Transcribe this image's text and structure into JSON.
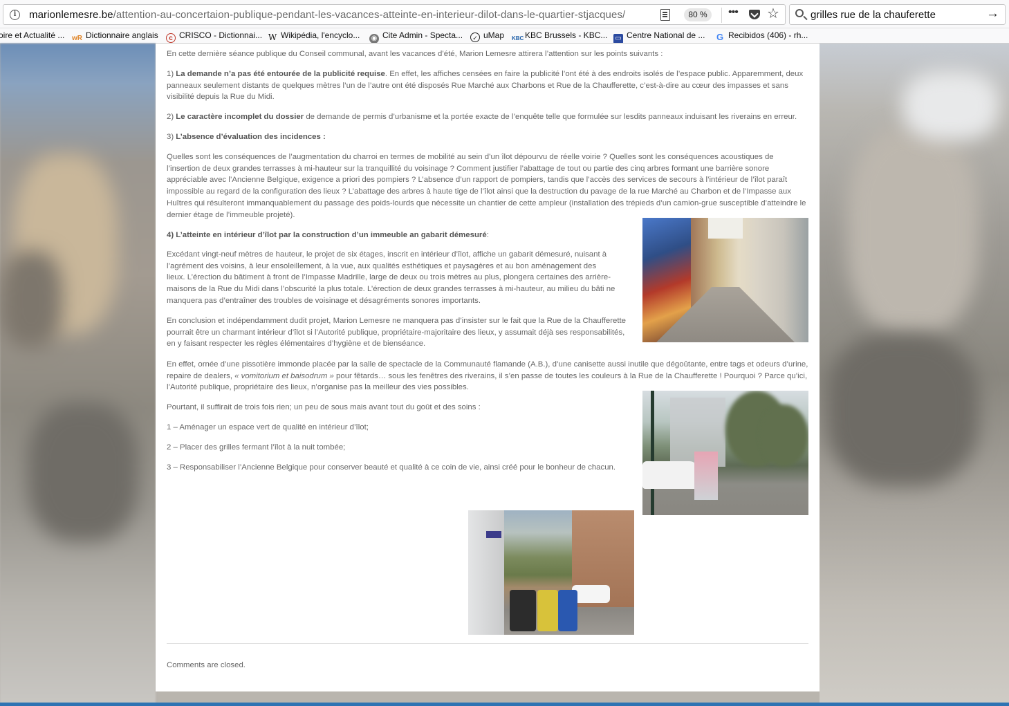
{
  "browser": {
    "url_domain": "marionlemesre.be",
    "url_path": "/attention-au-concertaion-publique-pendant-les-vacances-atteinte-en-interieur-dilot-dans-le-quartier-stjacques/",
    "zoom": "80 %",
    "search_query": "grilles rue de la chauferette",
    "bookmarks": [
      {
        "label": "oire et Actualité ...",
        "icon": "bookmark-icon"
      },
      {
        "label": "Dictionnaire anglais",
        "icon": "wordreference-icon"
      },
      {
        "label": "CRISCO - Dictionnai...",
        "icon": "crisco-icon"
      },
      {
        "label": "Wikipédia, l'encyclo...",
        "icon": "wikipedia-icon"
      },
      {
        "label": "Cite Admin - Specta...",
        "icon": "globe-icon"
      },
      {
        "label": "uMap",
        "icon": "umap-icon"
      },
      {
        "label": "KBC Brussels - KBC...",
        "icon": "kbc-icon"
      },
      {
        "label": "Centre National de ...",
        "icon": "cnrtl-icon"
      },
      {
        "label": "Recibidos (406) - rh...",
        "icon": "google-icon"
      }
    ]
  },
  "article": {
    "intro": "En cette dernière séance publique du Conseil communal, avant les vacances d’été, Marion Lemesre attirera l’attention sur les points suivants :",
    "p1_num": "1) ",
    "p1_bold": "La demande n’a pas été entourée de la publicité requise",
    "p1_rest": ". En effet, les affiches censées en faire la publicité l’ont été à des endroits isolés de l’espace public. Apparemment, deux panneaux seulement distants de quelques mètres l’un de l’autre ont été disposés Rue Marché aux Charbons et Rue de la Chaufferette, c’est-à-dire au cœur des impasses et sans visibilité depuis la Rue du Midi.",
    "p2_num": "2) ",
    "p2_bold": "Le caractère incomplet du dossier",
    "p2_rest": " de demande de permis d’urbanisme et la portée exacte de l’enquête telle que formulée sur lesdits panneaux induisant les riverains en erreur.",
    "p3_num": "3) ",
    "p3_bold": "L’absence d’évaluation des incidences :",
    "p4": "Quelles sont les conséquences de l’augmentation du charroi en termes de mobilité au sein d’un îlot dépourvu de réelle voirie ? Quelles sont les conséquences acoustiques de l’insertion de deux grandes terrasses à mi-hauteur sur la tranquillité du voisinage ? Comment justifier l’abattage de tout ou partie des cinq arbres formant une barrière sonore appréciable avec l’Ancienne Belgique, exigence a priori des pompiers ? L’absence d’un rapport de pompiers, tandis que l’accès des services de secours à l’intérieur de l’îlot paraît impossible au regard de la configuration des lieux ? L’abattage des arbres à haute tige de l’îlot ainsi que la destruction du pavage de la rue Marché au Charbon et de l’Impasse aux Huîtres qui résulteront immanquablement du passage des poids-lourds que nécessite un chantier de cette ampleur (installation des trépieds d’un camion-grue susceptible d’atteindre le dernier étage de l’immeuble projeté).",
    "p5_bold": "4) L’atteinte  en intérieur d’îlot par la construction d’un immeuble an gabarit démesuré",
    "p5_colon": ":",
    "p6": "Excédant vingt-neuf mètres de hauteur, le projet de six étages, inscrit en intérieur d’îlot, affiche un gabarit démesuré, nuisant à l’agrément des voisins, à leur ensoleillement, à la vue, aux qualités esthétiques et paysagères et au bon aménagement des lieux. L’érection du bâtiment à front de l’Impasse Madrille, large de deux ou trois mètres au plus, plongera certaines des arrière-maisons de la Rue du Midi dans l’obscurité la plus totale. L’érection de deux grandes terrasses à mi-hauteur, au milieu du bâti ne manquera pas d’entraîner des troubles de voisinage et désagréments sonores importants.",
    "p7": "En conclusion et indépendamment dudit projet, Marion Lemesre ne manquera pas d’insister  sur le fait que la Rue de la Chaufferette pourrait être un charmant intérieur d’îlot si l’Autorité publique, propriétaire-majoritaire des lieux, y assumait déjà ses responsabilités, en y faisant  respecter les règles élémentaires d’hygiène et de bienséance.",
    "p8_a": "En effet, ornée d’une pissotière immonde placée par la salle de spectacle de la Communauté flamande (A.B.), d’une canisette aussi inutile que dégoûtante, entre tags et odeurs d’urine, repaire de dealers, ",
    "p8_i": "« vomitorium et baisodrum »",
    "p8_b": " pour fêtards… sous les fenêtres des riverains, il s’en passe de toutes les couleurs à la Rue de la Chaufferette ! Pourquoi ? Parce qu’ici, l’Autorité publique, propriétaire des lieux, n’organise pas la meilleur des vies possibles.",
    "p9": "Pourtant, il suffirait de trois fois rien; un peu de sous mais avant tout du goût et des soins :",
    "list1": "1 – Aménager un espace vert de qualité en intérieur d’îlot;",
    "list2": "2 – Placer des grilles fermant l’îlot à la nuit tombée;",
    "list3": "3 – Responsabiliser l’Ancienne Belgique pour conserver beauté et qualité à ce coin de vie, ainsi créé pour le bonheur de chacun.",
    "comments": "Comments are closed."
  },
  "colors": {
    "text": "#666666",
    "chrome": "#f9f9fa",
    "accent_bar": "#2e73b3"
  }
}
